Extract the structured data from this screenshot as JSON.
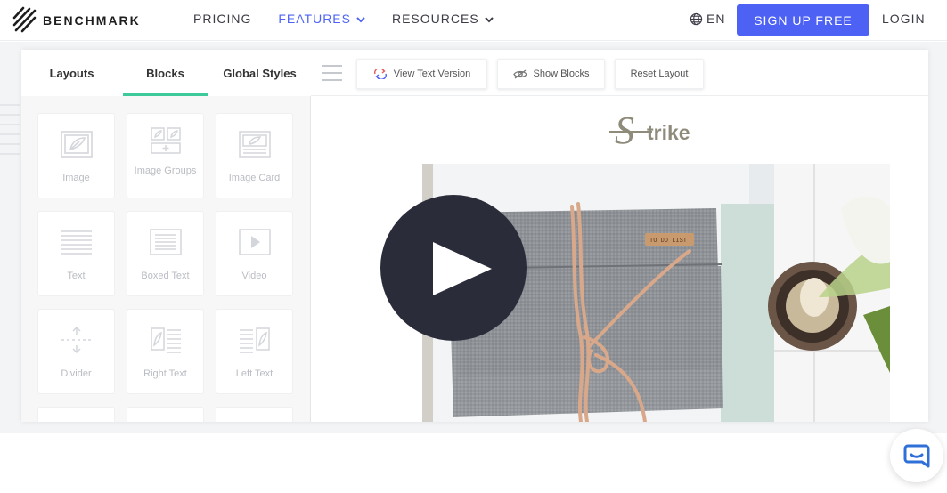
{
  "brand": {
    "name": "BENCHMARK"
  },
  "nav": {
    "items": [
      {
        "label": "PRICING",
        "has_dropdown": false,
        "active": false
      },
      {
        "label": "FEATURES",
        "has_dropdown": true,
        "active": true
      },
      {
        "label": "RESOURCES",
        "has_dropdown": true,
        "active": false
      }
    ],
    "language": "EN",
    "signup_label": "SIGN UP FREE",
    "login_label": "LOGIN"
  },
  "editor": {
    "tabs": [
      {
        "label": "Layouts",
        "active": false
      },
      {
        "label": "Blocks",
        "active": true
      },
      {
        "label": "Global Styles",
        "active": false
      }
    ],
    "toolbar": {
      "view_text_label": "View Text Version",
      "show_blocks_label": "Show Blocks",
      "reset_layout_label": "Reset Layout"
    },
    "blocks": [
      {
        "label": "Image",
        "icon": "image-icon"
      },
      {
        "label": "Image Groups",
        "icon": "image-groups-icon"
      },
      {
        "label": "Image Card",
        "icon": "image-card-icon"
      },
      {
        "label": "Text",
        "icon": "text-icon"
      },
      {
        "label": "Boxed Text",
        "icon": "boxed-text-icon"
      },
      {
        "label": "Video",
        "icon": "video-icon"
      },
      {
        "label": "Divider",
        "icon": "divider-icon"
      },
      {
        "label": "Right Text",
        "icon": "right-text-icon"
      },
      {
        "label": "Left Text",
        "icon": "left-text-icon"
      }
    ],
    "canvas": {
      "logo_text": "trike",
      "product_tag": "TO DO LIST"
    }
  },
  "colors": {
    "accent": "#4d62f5",
    "tab_underline": "#3ec99b",
    "play_button": "#2b2c3a"
  }
}
